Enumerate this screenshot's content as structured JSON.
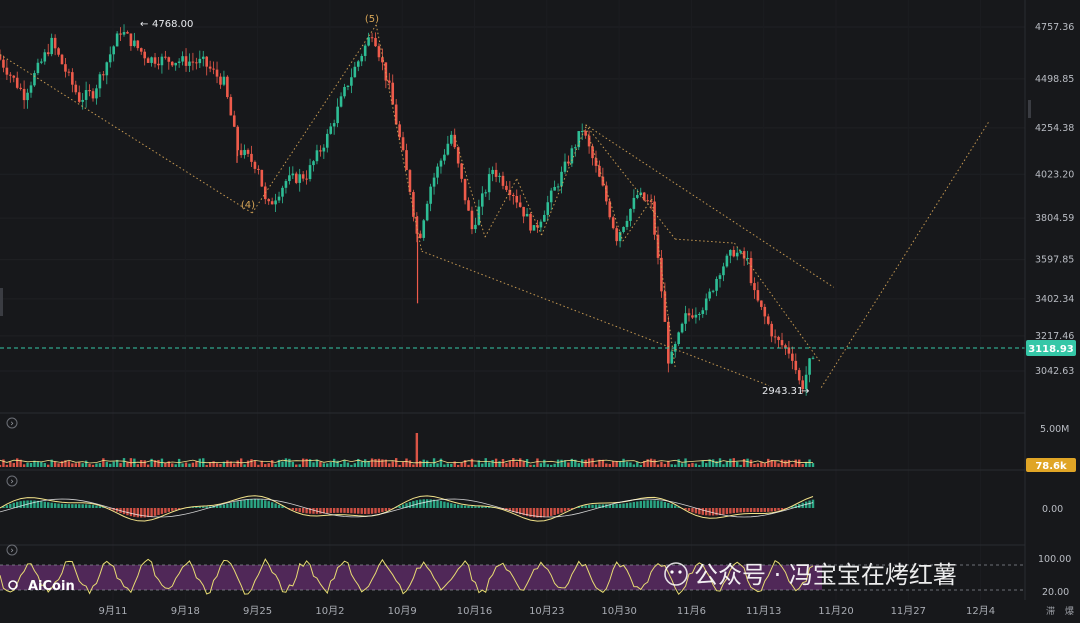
{
  "colors": {
    "background": "#17181b",
    "up": "#2ebd95",
    "down": "#ee5b4b",
    "trendline": "#d8a657",
    "macd_line": "#f2e28a",
    "price_line": "#35c7a7",
    "volume_badge": "#e0a526",
    "rsi_band": "#5a2b63",
    "rsi_line": "#e8dc72"
  },
  "chart_data": {
    "type": "candlestick",
    "price_axis": {
      "ticks": [
        "4757.36",
        "4498.85",
        "4254.38",
        "4023.20",
        "3804.59",
        "3597.85",
        "3402.34",
        "3217.46",
        "3042.63"
      ],
      "ylim": [
        2850,
        4900
      ]
    },
    "current_price": "3118.93",
    "x_axis": {
      "ticks": [
        "9月11",
        "9月18",
        "9月25",
        "10月2",
        "10月9",
        "10月16",
        "10月23",
        "10月30",
        "11月6",
        "11月13",
        "11月20",
        "11月27",
        "12月4"
      ]
    },
    "annotations": {
      "high_label": "4768.00",
      "low_label": "2943.31",
      "high_value": 4768,
      "low_value": 2943.31
    },
    "wave_labels": [
      {
        "label": "(4)",
        "date_index": 19.5,
        "price": 3830
      },
      {
        "label": "(5)",
        "date_index": 27.1,
        "price": 4768
      }
    ],
    "trend_path": [
      {
        "d": 0,
        "p": 4620
      },
      {
        "d": 2,
        "p": 4420
      },
      {
        "d": 4,
        "p": 4680
      },
      {
        "d": 6,
        "p": 4400
      },
      {
        "d": 7,
        "p": 4430
      },
      {
        "d": 9,
        "p": 4740
      },
      {
        "d": 11,
        "p": 4600
      },
      {
        "d": 13,
        "p": 4590
      },
      {
        "d": 15,
        "p": 4580
      },
      {
        "d": 16.5,
        "p": 4480
      },
      {
        "d": 17.5,
        "p": 4150
      },
      {
        "d": 19,
        "p": 4060
      },
      {
        "d": 19.6,
        "p": 3850
      },
      {
        "d": 21,
        "p": 3990
      },
      {
        "d": 22.5,
        "p": 4020
      },
      {
        "d": 24,
        "p": 4210
      },
      {
        "d": 25.5,
        "p": 4480
      },
      {
        "d": 27.3,
        "p": 4740
      },
      {
        "d": 28.5,
        "p": 4450
      },
      {
        "d": 30,
        "p": 3950
      },
      {
        "d": 30.6,
        "p": 3680
      },
      {
        "d": 31.4,
        "p": 3950
      },
      {
        "d": 33,
        "p": 4220
      },
      {
        "d": 34.5,
        "p": 3750
      },
      {
        "d": 36,
        "p": 4050
      },
      {
        "d": 37.5,
        "p": 3930
      },
      {
        "d": 39,
        "p": 3740
      },
      {
        "d": 41,
        "p": 4020
      },
      {
        "d": 42.5,
        "p": 4250
      },
      {
        "d": 44,
        "p": 3950
      },
      {
        "d": 45,
        "p": 3710
      },
      {
        "d": 46.5,
        "p": 3920
      },
      {
        "d": 47.5,
        "p": 3870
      },
      {
        "d": 48.2,
        "p": 3480
      },
      {
        "d": 48.8,
        "p": 3070
      },
      {
        "d": 50,
        "p": 3310
      },
      {
        "d": 51.5,
        "p": 3380
      },
      {
        "d": 52.5,
        "p": 3550
      },
      {
        "d": 53.5,
        "p": 3640
      },
      {
        "d": 54.5,
        "p": 3590
      },
      {
        "d": 55,
        "p": 3420
      },
      {
        "d": 56.5,
        "p": 3200
      },
      {
        "d": 57.7,
        "p": 3130
      },
      {
        "d": 58.4,
        "p": 2950
      },
      {
        "d": 59,
        "p": 3080
      }
    ],
    "spikes": [
      {
        "d": 17.2,
        "low": 4080
      },
      {
        "d": 30.3,
        "low": 3380
      }
    ],
    "trendlines": [
      {
        "from": {
          "d": 0,
          "p": 4620
        },
        "to": {
          "d": 18.3,
          "p": 3830
        }
      },
      {
        "from": {
          "d": 18.3,
          "p": 3830
        },
        "to": {
          "d": 27.3,
          "p": 4768
        }
      },
      {
        "from": {
          "d": 27.3,
          "p": 4768
        },
        "to": {
          "d": 30.6,
          "p": 3640
        }
      },
      {
        "from": {
          "d": 30.6,
          "p": 3640
        },
        "to": {
          "d": 55.8,
          "p": 2970
        }
      },
      {
        "from": {
          "d": 42.5,
          "p": 4270
        },
        "to": {
          "d": 60.5,
          "p": 3460
        }
      },
      {
        "from": {
          "d": 42.5,
          "p": 4270
        },
        "to": {
          "d": 49,
          "p": 3700
        }
      },
      {
        "from": {
          "d": 49,
          "p": 3700
        },
        "to": {
          "d": 53.3,
          "p": 3680
        }
      },
      {
        "from": {
          "d": 53.3,
          "p": 3680
        },
        "to": {
          "d": 59.5,
          "p": 3090
        }
      },
      {
        "from": {
          "d": 59.6,
          "p": 2960
        },
        "to": {
          "d": 71.8,
          "p": 4290
        }
      },
      {
        "from": {
          "d": 33,
          "p": 4210
        },
        "to": {
          "d": 35.2,
          "p": 3710
        }
      },
      {
        "from": {
          "d": 35.2,
          "p": 3710
        },
        "to": {
          "d": 37.5,
          "p": 4000
        }
      },
      {
        "from": {
          "d": 37.5,
          "p": 4000
        },
        "to": {
          "d": 39.3,
          "p": 3720
        }
      },
      {
        "from": {
          "d": 39.3,
          "p": 3720
        },
        "to": {
          "d": 42.5,
          "p": 4260
        }
      },
      {
        "from": {
          "d": 42.5,
          "p": 4260
        },
        "to": {
          "d": 45.2,
          "p": 3690
        }
      },
      {
        "from": {
          "d": 45.2,
          "p": 3690
        },
        "to": {
          "d": 47.3,
          "p": 3900
        }
      },
      {
        "from": {
          "d": 47.3,
          "p": 3900
        },
        "to": {
          "d": 49,
          "p": 3060
        }
      }
    ],
    "volume_panel": {
      "tick": "5.00M",
      "current": "78.6k",
      "spike_index": 30.3
    },
    "macd_panel": {
      "tick": "0.00"
    },
    "rsi_panel": {
      "ticks": [
        "100.00",
        "20.00"
      ]
    }
  },
  "watermark": {
    "text": "公众号 · 冯宝宝在烤红薯"
  },
  "logo": {
    "text": "AiCoin"
  },
  "corner": {
    "left": "滞",
    "right": "爆"
  }
}
